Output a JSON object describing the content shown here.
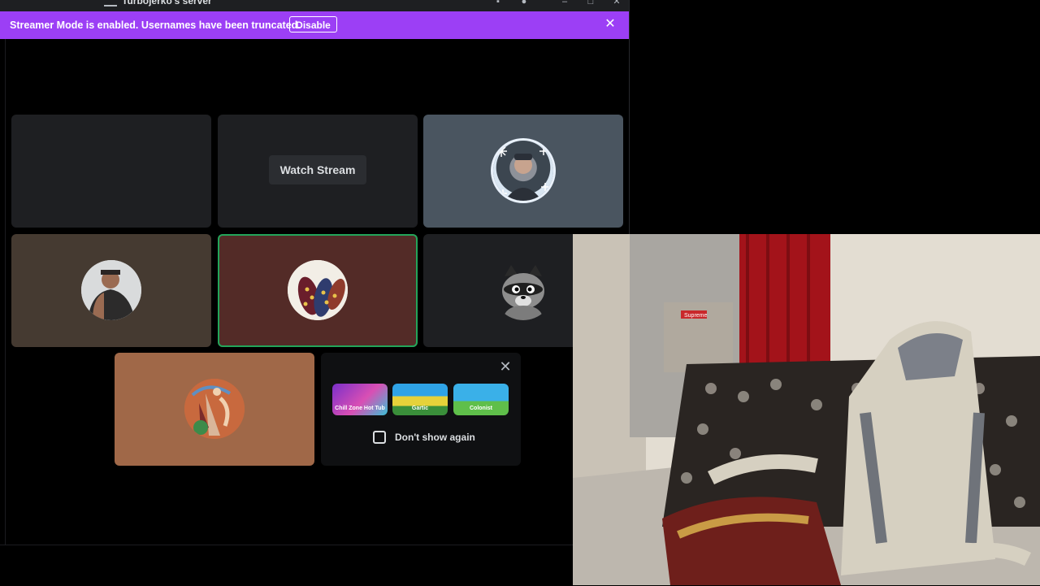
{
  "window": {
    "server_name": "Turbojerko's server",
    "controls": [
      "inbox-icon",
      "help-icon",
      "minimize-icon",
      "maximize-icon",
      "close-icon"
    ]
  },
  "banner": {
    "message": "Streamer Mode is enabled. Usernames have been truncated.",
    "disable_label": "Disable",
    "close_icon": "close-icon",
    "color": "#9c3ff5"
  },
  "tiles": [
    {
      "kind": "empty",
      "bg": "#1e1f22"
    },
    {
      "kind": "stream",
      "bg": "#1e1f22",
      "button_label": "Watch Stream"
    },
    {
      "kind": "avatar",
      "bg": "#4a5560",
      "icon": "snowflake-frame-avatar"
    },
    {
      "kind": "avatar",
      "bg": "#453a31",
      "icon": "user-avatar"
    },
    {
      "kind": "avatar",
      "bg": "#532b27",
      "icon": "corn-avatar",
      "speaking": true,
      "speaking_color": "#23a55a"
    },
    {
      "kind": "avatar",
      "bg": "#1e1f22",
      "icon": "raccoon-avatar"
    },
    {
      "kind": "avatar",
      "bg": "#a06848",
      "icon": "artwork-avatar"
    }
  ],
  "promo": {
    "close_icon": "close-icon",
    "games": [
      "Chill Zone Hot Tub",
      "Gartic",
      "Colonist"
    ],
    "checkbox_label": "Don't show again",
    "checked": false
  },
  "webcam": {
    "scene": "bedroom-webcam",
    "sign_text": "Supreme"
  }
}
